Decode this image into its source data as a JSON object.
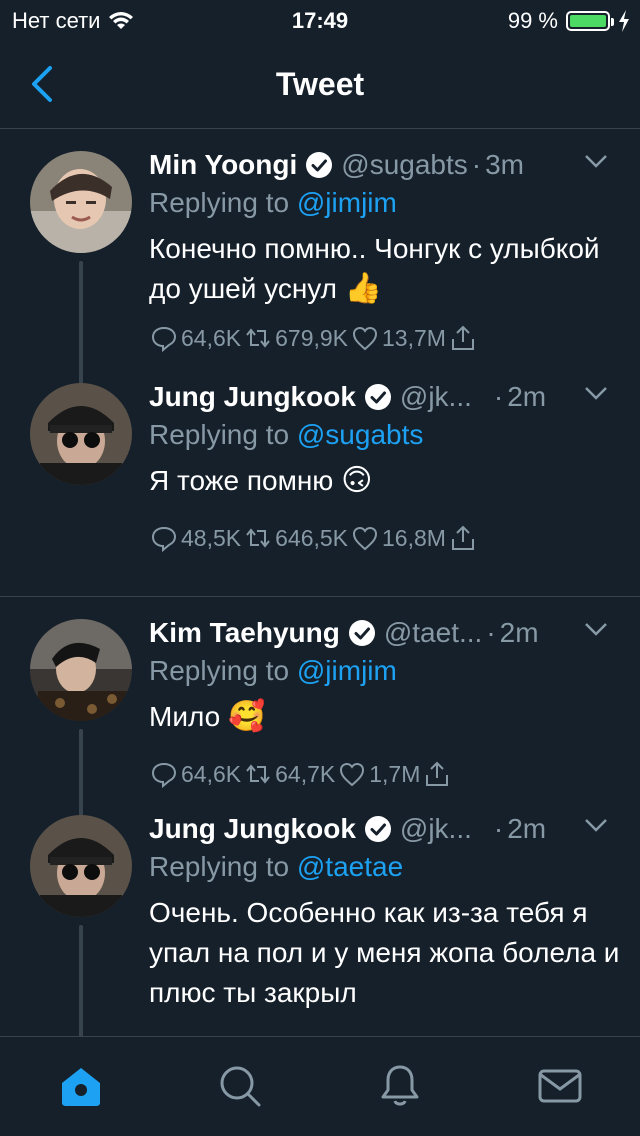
{
  "status_bar": {
    "carrier": "Нет сети",
    "time": "17:49",
    "battery": "99 %",
    "battery_level": 0.99
  },
  "nav": {
    "title": "Tweet"
  },
  "tweets": [
    {
      "name": "Min Yoongi",
      "handle": "@sugabts",
      "dot": "·",
      "time": "3m",
      "replying_prefix": "Replying to ",
      "replying_to": "@jimjim",
      "text": "Конечно помню.. Чонгук с улыбкой до ушей уснул",
      "emoji": "👍",
      "replies": "64,6K",
      "retweets": "679,9K",
      "likes": "13,7M"
    },
    {
      "name": "Jung Jungkook",
      "handle": "@jk...",
      "dot": "·",
      "time": "2m",
      "replying_prefix": "Replying to ",
      "replying_to": "@sugabts",
      "text": "Я тоже помню",
      "emoji": "🙃",
      "replies": "48,5K",
      "retweets": "646,5K",
      "likes": "16,8M"
    },
    {
      "name": "Kim Taehyung",
      "handle": "@taet...",
      "dot": "·",
      "time": "2m",
      "replying_prefix": "Replying to ",
      "replying_to": "@jimjim",
      "text": "Мило",
      "emoji": "🥰",
      "replies": "64,6K",
      "retweets": "64,7K",
      "likes": "1,7M"
    },
    {
      "name": "Jung Jungkook",
      "handle": "@jk...",
      "dot": "·",
      "time": "2m",
      "replying_prefix": "Replying to ",
      "replying_to": "@taetae",
      "text": "Очень. Особенно как из-за тебя я упал на пол и у меня жопа болела и плюс ты закрыл"
    }
  ],
  "tabs": [
    "home-icon",
    "search-icon",
    "notifications-icon",
    "messages-icon"
  ],
  "colors": {
    "background": "#15202b",
    "accent": "#1da1f2",
    "muted": "#8899a6",
    "divider": "#38444d"
  }
}
